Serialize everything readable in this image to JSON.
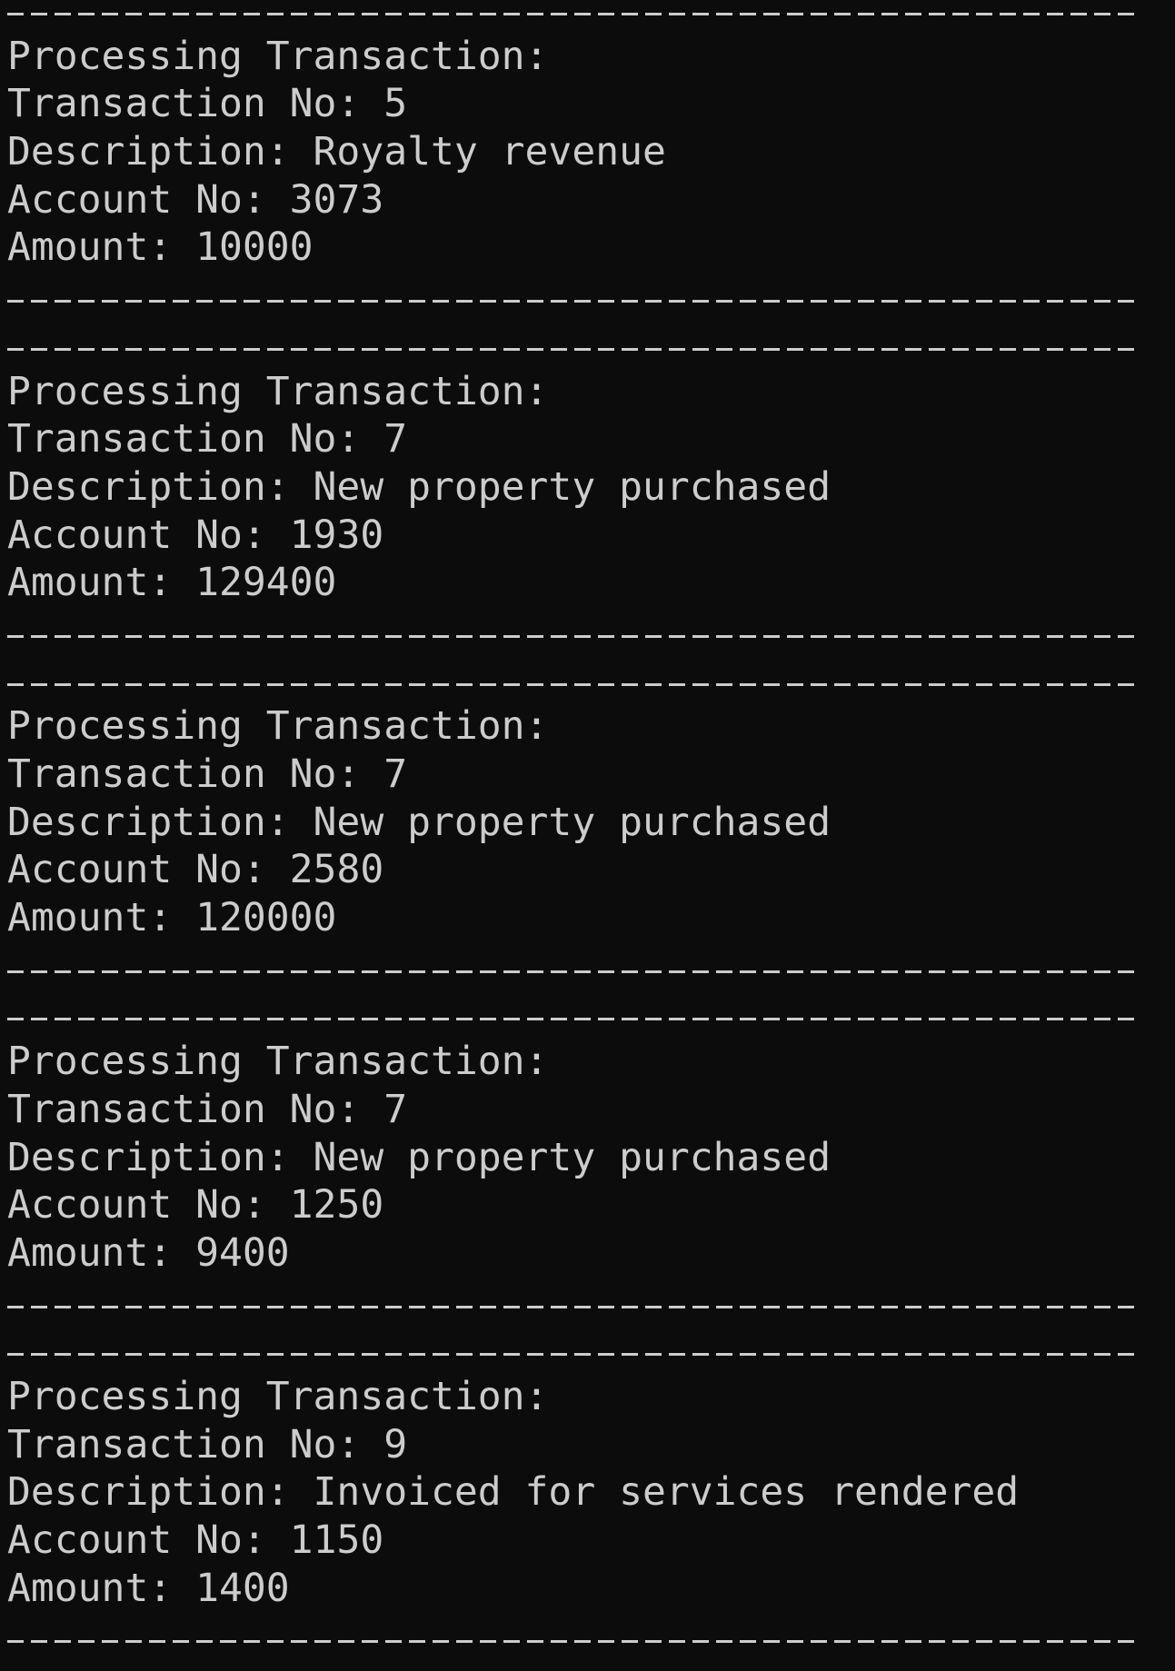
{
  "terminal": {
    "heading_label": "Processing Transaction:",
    "transaction_no_label": "Transaction No: ",
    "description_label": "Description: ",
    "account_no_label": "Account No: ",
    "amount_label": "Amount: "
  },
  "transactions": [
    {
      "transaction_no": "5",
      "description": "Royalty revenue",
      "account_no": "3073",
      "amount": "10000"
    },
    {
      "transaction_no": "7",
      "description": "New property purchased",
      "account_no": "1930",
      "amount": "129400"
    },
    {
      "transaction_no": "7",
      "description": "New property purchased",
      "account_no": "2580",
      "amount": "120000"
    },
    {
      "transaction_no": "7",
      "description": "New property purchased",
      "account_no": "1250",
      "amount": "9400"
    },
    {
      "transaction_no": "9",
      "description": "Invoiced for services rendered",
      "account_no": "1150",
      "amount": "1400"
    }
  ]
}
